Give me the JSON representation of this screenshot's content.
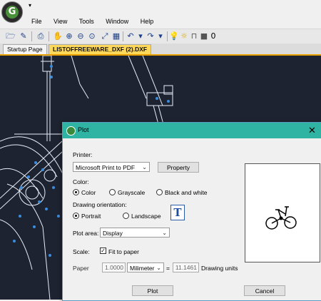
{
  "quick_access": "▾",
  "menu": [
    "File",
    "View",
    "Tools",
    "Window",
    "Help"
  ],
  "toolbar_zero": "0",
  "tabs": {
    "start": "Startup Page",
    "active": "LISTOFFREEWARE_DXF (2).DXF"
  },
  "dialog": {
    "title": "Plot",
    "close": "✕",
    "printer_label": "Printer:",
    "printer_value": "Microsoft Print to PDF",
    "property_button": "Property",
    "color_label": "Color:",
    "color_options": [
      "Color",
      "Grayscale",
      "Black and white"
    ],
    "color_selected": "Color",
    "orientation_label": "Drawing orientation:",
    "orientation_options": [
      "Portrait",
      "Landscape"
    ],
    "orientation_selected": "Portrait",
    "orientation_icon_glyph": "T",
    "plot_area_label": "Plot area:",
    "plot_area_value": "Display",
    "scale_label": "Scale:",
    "fit_to_paper_label": "Fit to paper",
    "fit_to_paper_checked": true,
    "paper_label": "Paper",
    "paper_value": "1.0000",
    "unit_value": "Milimeter",
    "equals": "=",
    "drawing_value": "11.1461",
    "drawing_units_label": "Drawing units",
    "plot_button": "Plot",
    "cancel_button": "Cancel"
  },
  "colors": {
    "canvas": "#1d2330",
    "title_accent": "#2fb3a2",
    "tab_active": "#fdd85a",
    "drawing_lines": "#e8eef8",
    "drawing_points": "#3a8ce0"
  }
}
